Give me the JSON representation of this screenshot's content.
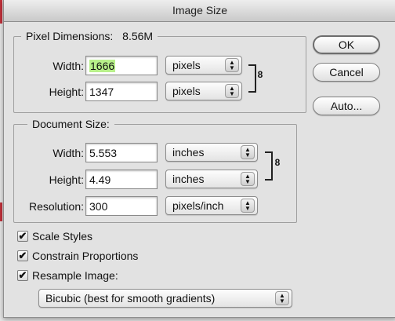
{
  "window": {
    "title": "Image Size"
  },
  "pixel_dimensions": {
    "legend": "Pixel Dimensions:",
    "size": "8.56M",
    "width_label": "Width:",
    "width_value": "1666",
    "width_unit": "pixels",
    "height_label": "Height:",
    "height_value": "1347",
    "height_unit": "pixels"
  },
  "document_size": {
    "legend": "Document Size:",
    "width_label": "Width:",
    "width_value": "5.553",
    "width_unit": "inches",
    "height_label": "Height:",
    "height_value": "4.49",
    "height_unit": "inches",
    "resolution_label": "Resolution:",
    "resolution_value": "300",
    "resolution_unit": "pixels/inch"
  },
  "buttons": {
    "ok": "OK",
    "cancel": "Cancel",
    "auto": "Auto..."
  },
  "options": {
    "scale_styles": {
      "label": "Scale Styles",
      "checked": true
    },
    "constrain_proportions": {
      "label": "Constrain Proportions",
      "checked": true
    },
    "resample_image": {
      "label": "Resample Image:",
      "checked": true
    },
    "resample_method": "Bicubic (best for smooth gradients)"
  },
  "icons": {
    "checkmark": "✔",
    "chain_link": "chain-link-icon",
    "stepper_arrows": "up-down-arrows-icon"
  },
  "colors": {
    "selection_highlight": "#b8f08a"
  }
}
